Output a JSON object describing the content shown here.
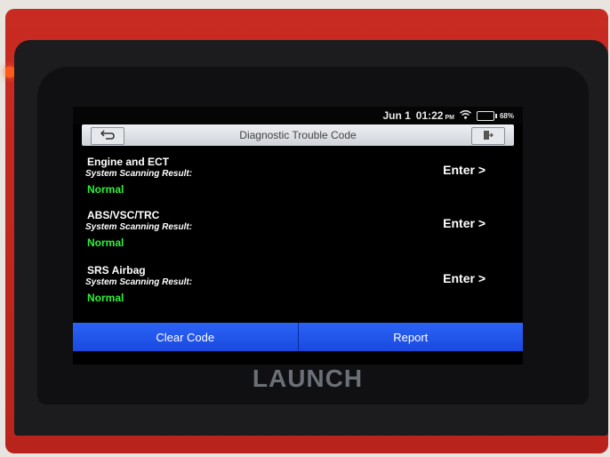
{
  "status_bar": {
    "date": "Jun 1",
    "time": "01:22",
    "ampm": "PM",
    "battery": "68%"
  },
  "title_bar": {
    "title": "Diagnostic Trouble Code",
    "back_icon": "back-arrow-icon",
    "exit_icon": "exit-icon"
  },
  "systems": [
    {
      "name": "Engine and ECT",
      "result_label": "System Scanning Result:",
      "result": "Normal",
      "action": "Enter >"
    },
    {
      "name": "ABS/VSC/TRC",
      "result_label": "System Scanning Result:",
      "result": "Normal",
      "action": "Enter >"
    },
    {
      "name": "SRS Airbag",
      "result_label": "System Scanning Result:",
      "result": "Normal",
      "action": "Enter >"
    }
  ],
  "actions": {
    "clear_label": "Clear Code",
    "report_label": "Report"
  },
  "device": {
    "brand": "LAUNCH"
  },
  "colors": {
    "normal": "#2cf03a",
    "button": "#2356ee",
    "device_red": "#c92b22"
  }
}
